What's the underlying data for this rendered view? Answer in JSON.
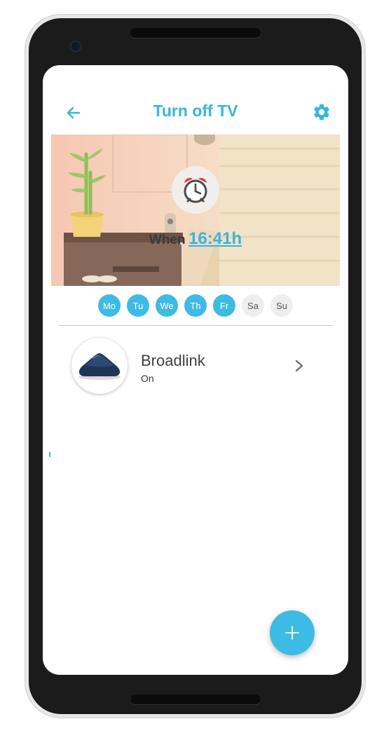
{
  "header": {
    "title": "Turn off TV",
    "back_icon": "arrow-left-icon",
    "settings_icon": "gear-icon",
    "accent_color": "#38b5de"
  },
  "schedule": {
    "when_label": "When",
    "time": "16:41h",
    "clock_icon": "alarm-clock-icon",
    "days": [
      {
        "label": "Mo",
        "active": true
      },
      {
        "label": "Tu",
        "active": true
      },
      {
        "label": "We",
        "active": true
      },
      {
        "label": "Th",
        "active": true
      },
      {
        "label": "Fr",
        "active": true
      },
      {
        "label": "Sa",
        "active": false
      },
      {
        "label": "Su",
        "active": false
      }
    ]
  },
  "devices": [
    {
      "name": "Broadlink",
      "status": "On",
      "icon": "broadlink-device-icon"
    }
  ],
  "fab": {
    "icon": "plus-icon",
    "color": "#3dbbe4"
  }
}
